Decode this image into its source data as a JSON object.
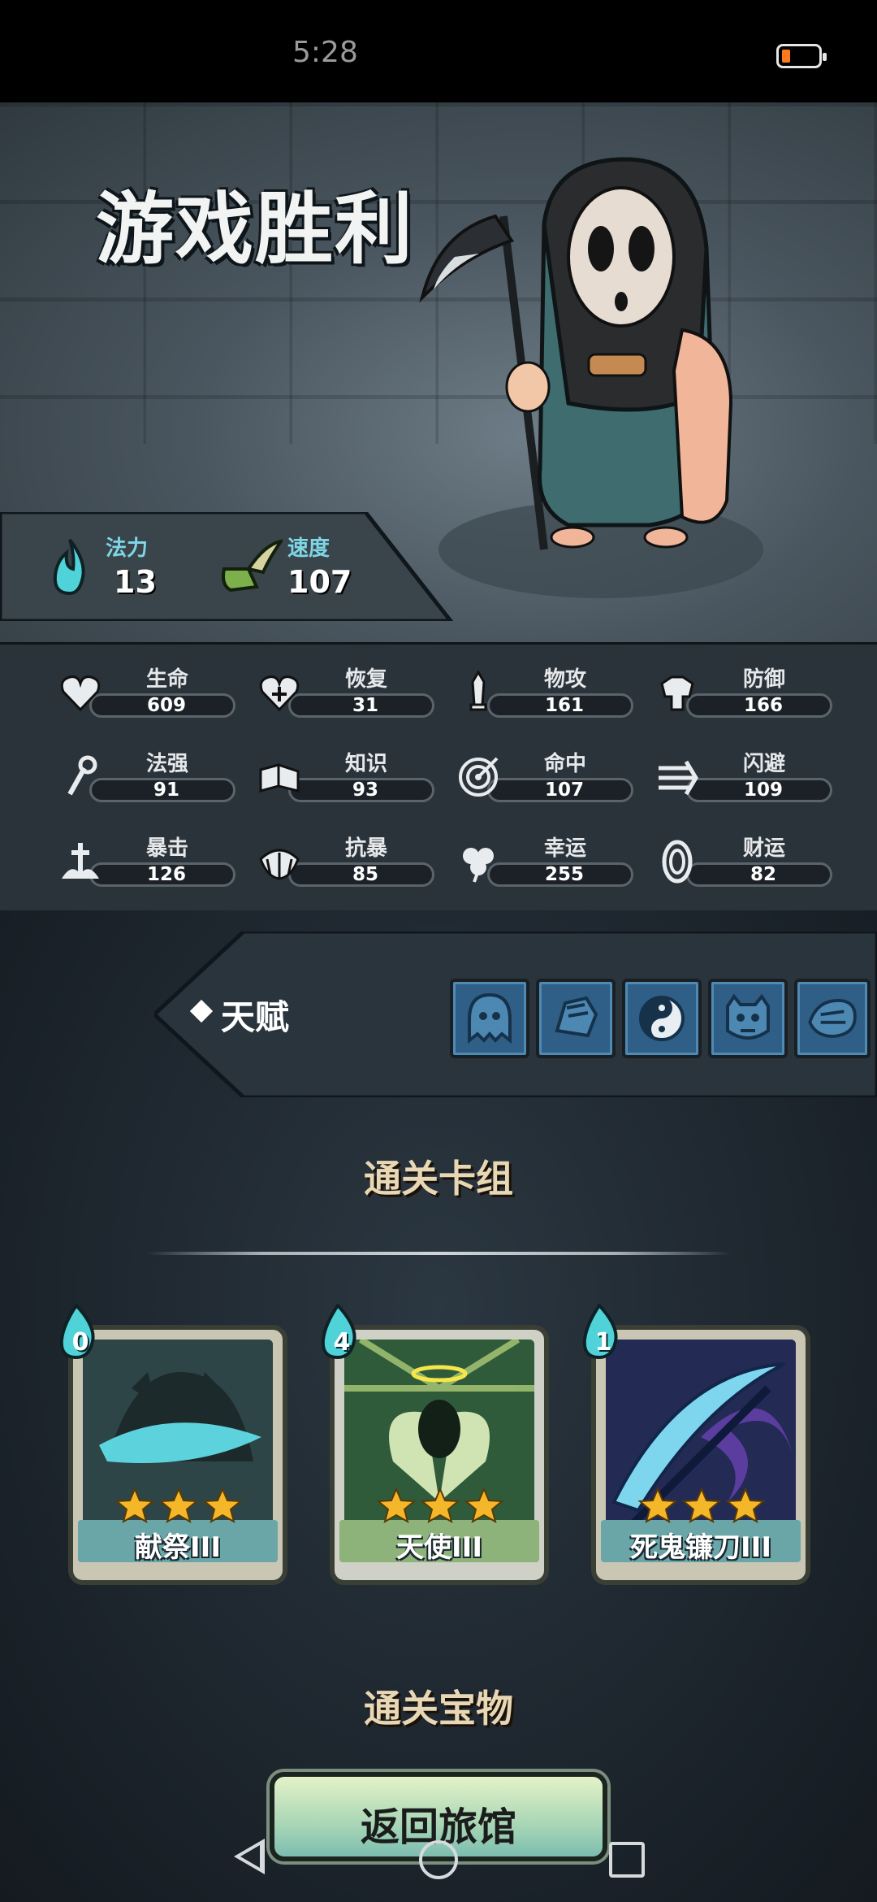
{
  "status_bar": {
    "time": "5:28",
    "battery_color": "#ff7a1a"
  },
  "hero": {
    "title": "游戏胜利"
  },
  "resources": {
    "mana": {
      "label": "法力",
      "value": "13",
      "icon": "flame-icon"
    },
    "speed": {
      "label": "速度",
      "value": "107",
      "icon": "winged-boot-icon"
    }
  },
  "stats": [
    {
      "label": "生命",
      "value": "609",
      "icon": "heart-icon"
    },
    {
      "label": "恢复",
      "value": "31",
      "icon": "heart-plus-icon"
    },
    {
      "label": "物攻",
      "value": "161",
      "icon": "sword-icon"
    },
    {
      "label": "防御",
      "value": "166",
      "icon": "armor-icon"
    },
    {
      "label": "法强",
      "value": "91",
      "icon": "staff-icon"
    },
    {
      "label": "知识",
      "value": "93",
      "icon": "book-icon"
    },
    {
      "label": "命中",
      "value": "107",
      "icon": "target-icon"
    },
    {
      "label": "闪避",
      "value": "109",
      "icon": "arrows-icon"
    },
    {
      "label": "暴击",
      "value": "126",
      "icon": "crit-sword-icon"
    },
    {
      "label": "抗暴",
      "value": "85",
      "icon": "shell-icon"
    },
    {
      "label": "幸运",
      "value": "255",
      "icon": "clover-icon"
    },
    {
      "label": "财运",
      "value": "82",
      "icon": "coin-icon"
    }
  ],
  "talents": {
    "label": "天赋",
    "icons": [
      "ghost-icon",
      "fist-icon",
      "yin-yang-icon",
      "ogre-icon",
      "beast-icon"
    ]
  },
  "deck": {
    "title": "通关卡组",
    "cards": [
      {
        "name": "献祭III",
        "cost": "0",
        "stars": 3
      },
      {
        "name": "天使III",
        "cost": "4",
        "stars": 3
      },
      {
        "name": "死鬼镰刀III",
        "cost": "1",
        "stars": 3
      }
    ]
  },
  "treasure": {
    "title": "通关宝物"
  },
  "return_button": {
    "label": "返回旅馆"
  }
}
